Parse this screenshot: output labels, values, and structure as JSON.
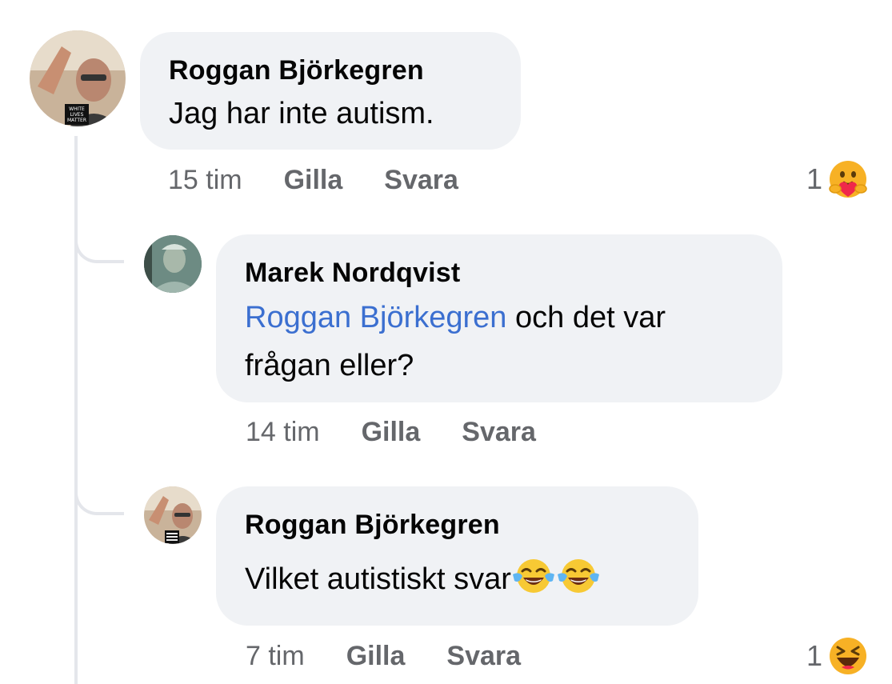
{
  "comments": [
    {
      "author": "Roggan Björkegren",
      "text": "Jag har inte autism.",
      "time": "15 tim",
      "like_label": "Gilla",
      "reply_label": "Svara",
      "reaction_count": "1",
      "reaction_icon": "care-emoji"
    },
    {
      "author": "Marek Nordqvist",
      "mention": "Roggan Björkegren",
      "text_after_mention": " och det var",
      "text_line2": "frågan eller?",
      "time": "14 tim",
      "like_label": "Gilla",
      "reply_label": "Svara"
    },
    {
      "author": "Roggan Björkegren",
      "text": "Vilket autistiskt svar",
      "emoji": "face-with-tears-of-joy x2",
      "time": "7 tim",
      "like_label": "Gilla",
      "reply_label": "Svara",
      "reaction_count": "1",
      "reaction_icon": "haha-emoji"
    }
  ],
  "avatar_badge_text": "WHITE LIVES MATTER",
  "colors": {
    "bubble": "#f0f2f5",
    "mention": "#3b6fd0",
    "meta": "#65676b",
    "thread_line": "#e4e6eb"
  }
}
